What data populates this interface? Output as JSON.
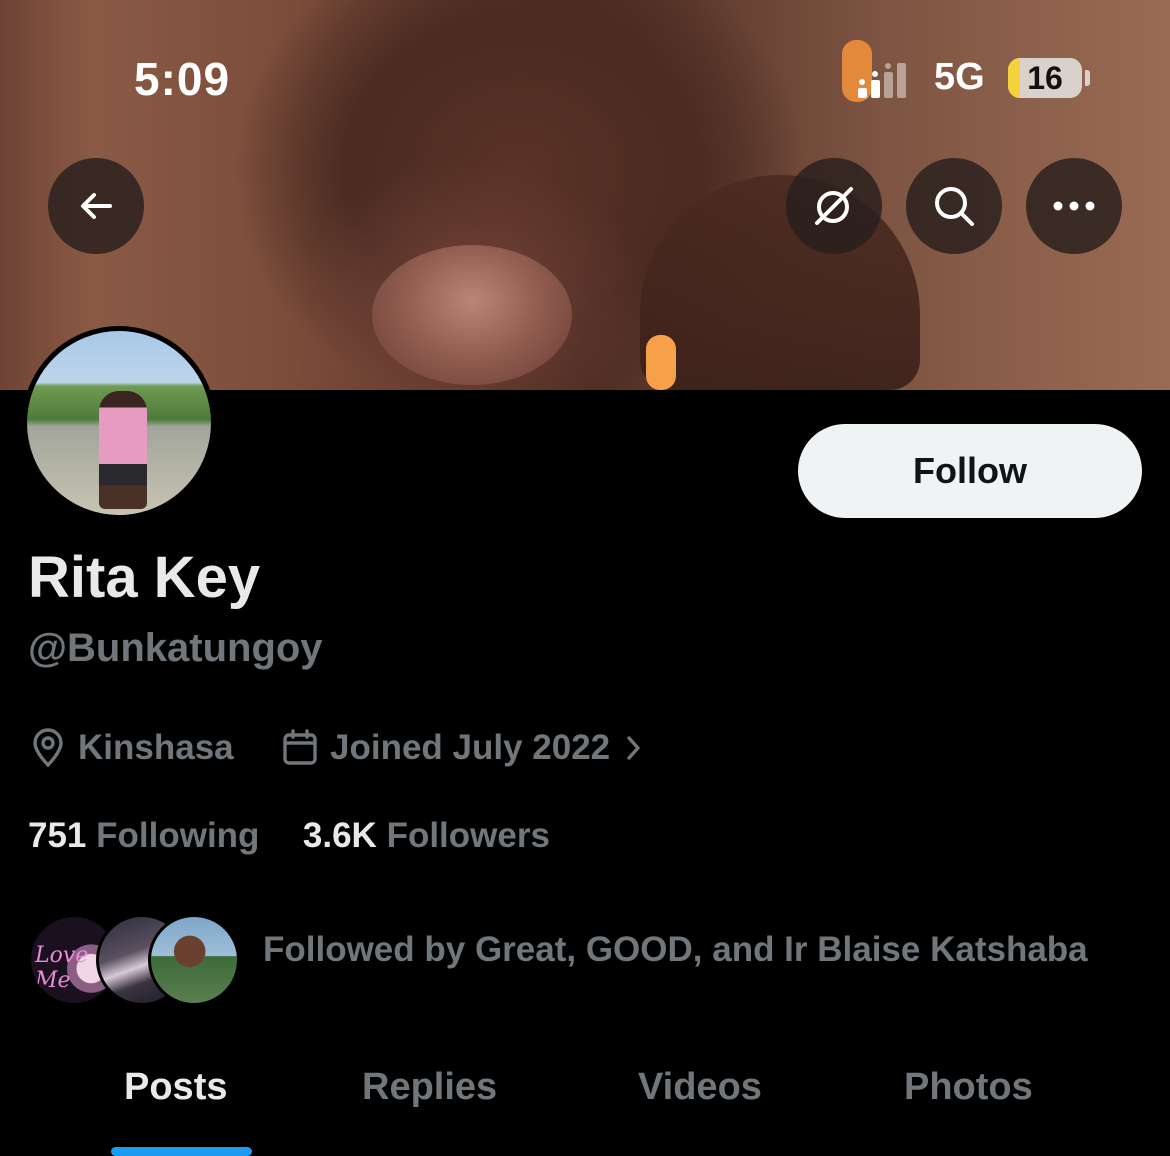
{
  "status_bar": {
    "time": "5:09",
    "network": "5G",
    "battery": "16",
    "battery_level_percent": 16
  },
  "header": {
    "back_icon": "arrow-left-icon",
    "grok_icon": "grok-slash-circle-icon",
    "search_icon": "search-icon",
    "more_icon": "more-horizontal-icon"
  },
  "profile": {
    "name": "Rita Key",
    "handle": "@Bunkatungoy",
    "location": "Kinshasa",
    "joined": "Joined July 2022",
    "follow_label": "Follow",
    "following_count": "751",
    "following_label": "Following",
    "followers_count": "3.6K",
    "followers_label": "Followers",
    "followed_by": "Followed by Great, GOOD, and Ir Blaise Katshaba",
    "mini_avatar_text": "Love Me"
  },
  "tabs": [
    {
      "label": "Posts",
      "active": true
    },
    {
      "label": "Replies",
      "active": false
    },
    {
      "label": "Videos",
      "active": false
    },
    {
      "label": "Photos",
      "active": false
    }
  ],
  "colors": {
    "accent": "#1d9bf0",
    "background": "#000000",
    "muted_text": "#71767b",
    "primary_text": "#e7e9ea"
  }
}
